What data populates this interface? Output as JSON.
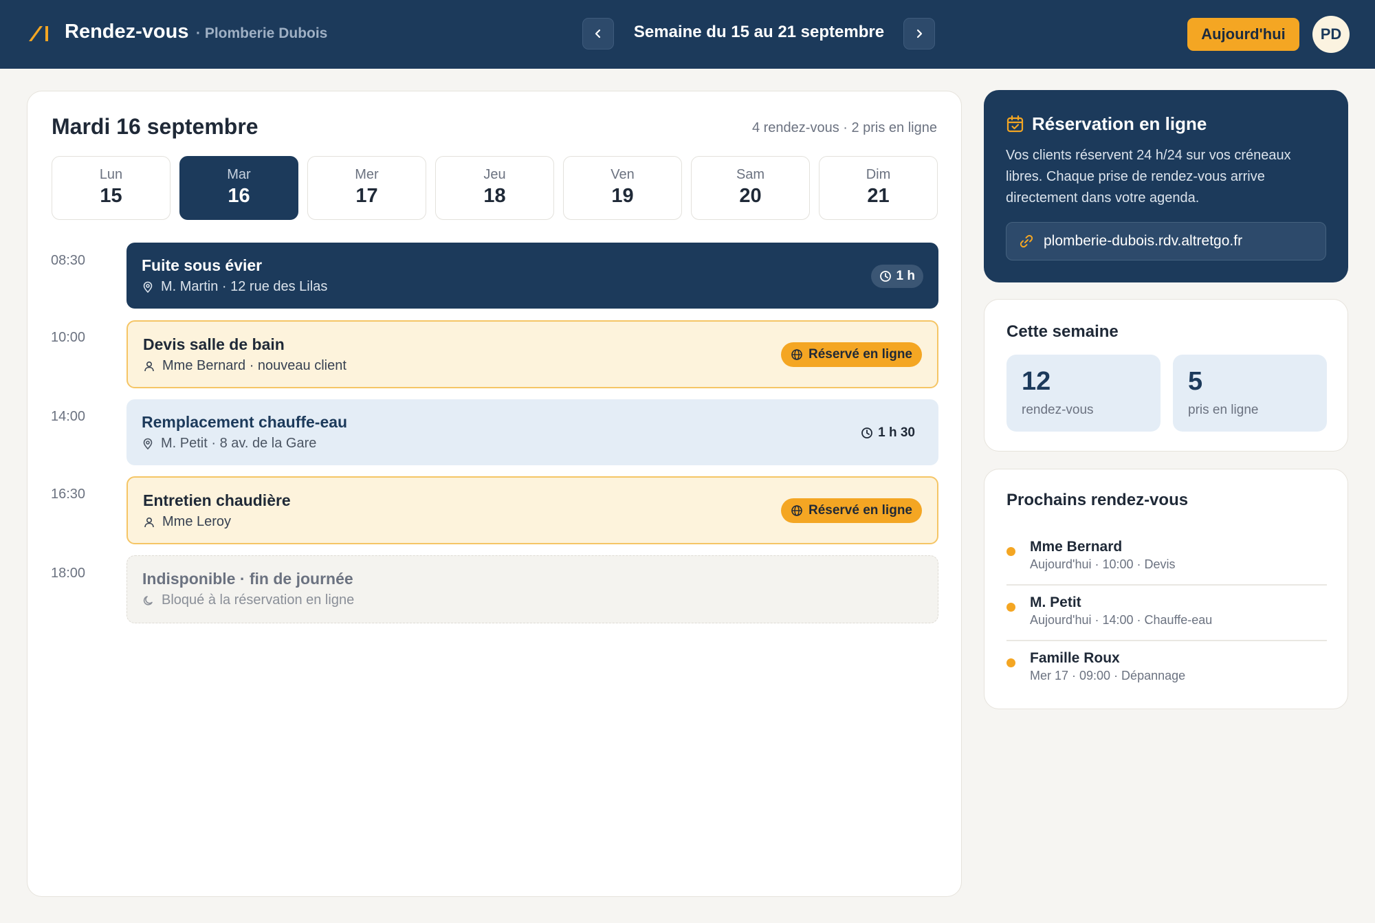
{
  "header": {
    "title": "Rendez-vous",
    "company": "· Plomberie Dubois",
    "week_label": "Semaine du 15 au 21 septembre",
    "today_button": "Aujourd'hui",
    "avatar_initials": "PD",
    "prev_icon": "chevron-left-icon",
    "next_icon": "chevron-right-icon"
  },
  "day": {
    "title": "Mardi 16 septembre",
    "summary": "4 rendez-vous · 2 pris en ligne"
  },
  "days": [
    {
      "name": "Lun",
      "num": "15"
    },
    {
      "name": "Mar",
      "num": "16"
    },
    {
      "name": "Mer",
      "num": "17"
    },
    {
      "name": "Jeu",
      "num": "18"
    },
    {
      "name": "Ven",
      "num": "19"
    },
    {
      "name": "Sam",
      "num": "20"
    },
    {
      "name": "Dim",
      "num": "21"
    }
  ],
  "selected_day": "16",
  "appointments": [
    {
      "time": "08:30",
      "title": "Fuite sous évier",
      "sub": "M. Martin · 12 rue des Lilas",
      "duration": "1 h",
      "style": "dark",
      "icon": "location-pin-icon"
    },
    {
      "time": "10:00",
      "title": "Devis salle de bain",
      "sub": "Mme Bernard · nouveau client",
      "badge": "Réservé en ligne",
      "style": "yellow",
      "icon": "person-icon"
    },
    {
      "time": "14:00",
      "title": "Remplacement chauffe-eau",
      "sub": "M. Petit · 8 av. de la Gare",
      "duration": "1 h 30",
      "style": "blue",
      "icon": "location-pin-icon"
    },
    {
      "time": "16:30",
      "title": "Entretien chaudière",
      "sub": "Mme Leroy",
      "badge": "Réservé en ligne",
      "style": "yellow",
      "icon": "person-icon"
    },
    {
      "time": "18:00",
      "title": "Indisponible · fin de journée",
      "sub": "Bloqué à la réservation en ligne",
      "style": "grey",
      "icon": "moon-icon"
    }
  ],
  "online_booking": {
    "title": "Réservation en ligne",
    "text": "Vos clients réservent 24 h/24 sur vos créneaux libres. Chaque prise de rendez-vous arrive directement dans votre agenda.",
    "link": "plomberie-dubois.rdv.altretgo.fr"
  },
  "week_stats": {
    "title": "Cette semaine",
    "stats": [
      {
        "num": "12",
        "label": "rendez-vous"
      },
      {
        "num": "5",
        "label": "pris en ligne"
      }
    ]
  },
  "upcoming": {
    "title": "Prochains rendez-vous",
    "items": [
      {
        "name": "Mme Bernard",
        "detail": "Aujourd'hui · 10:00 · Devis"
      },
      {
        "name": "M. Petit",
        "detail": "Aujourd'hui · 14:00 · Chauffe-eau"
      },
      {
        "name": "Famille Roux",
        "detail": "Mer 17 · 09:00 · Dépannage"
      }
    ]
  },
  "colors": {
    "navy": "#1c3a5b",
    "accent": "#f4a623",
    "background": "#f6f5f2"
  }
}
